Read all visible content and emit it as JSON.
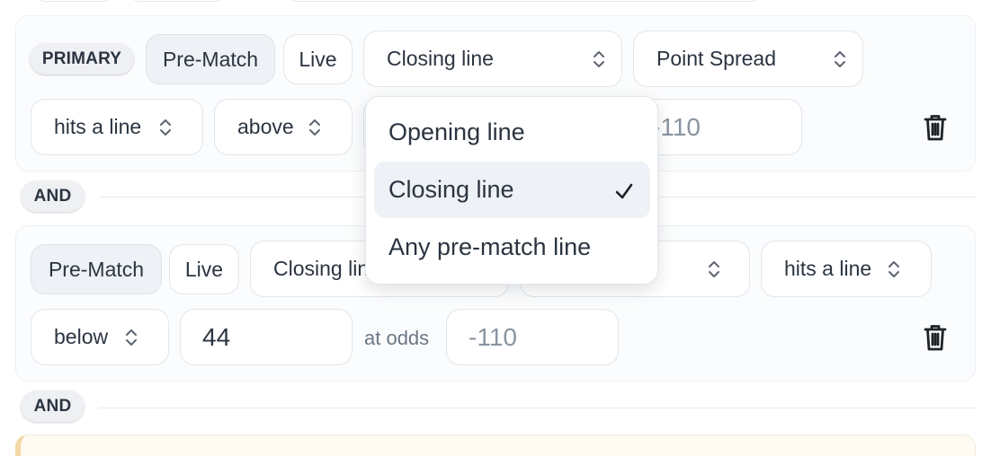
{
  "rule1": {
    "badge": "PRIMARY",
    "timing_tabs": [
      "Pre-Match",
      "Live"
    ],
    "line_type": "Closing line",
    "market": "Point Spread",
    "condition": "hits a line",
    "direction": "above",
    "odds_value": "-110"
  },
  "connector1": "AND",
  "rule2": {
    "timing_tabs": [
      "Pre-Match",
      "Live"
    ],
    "line_type": "Closing line",
    "condition": "hits a line",
    "direction": "below",
    "line_value": "44",
    "odds_label": "at odds",
    "odds_placeholder": "-110"
  },
  "connector2": "AND",
  "dropdown": {
    "options": [
      "Opening line",
      "Closing line",
      "Any pre-match line"
    ],
    "selected": "Closing line"
  },
  "icons": {
    "select": "up-down-chevron-icon",
    "delete": "trash-icon",
    "selected_mark": "check-icon"
  },
  "colors": {
    "card_bg": "#fbfcfd",
    "control_border": "#e2e6ea",
    "active_bg": "#eef2f6",
    "text": "#2b3440",
    "muted": "#6b7785"
  }
}
